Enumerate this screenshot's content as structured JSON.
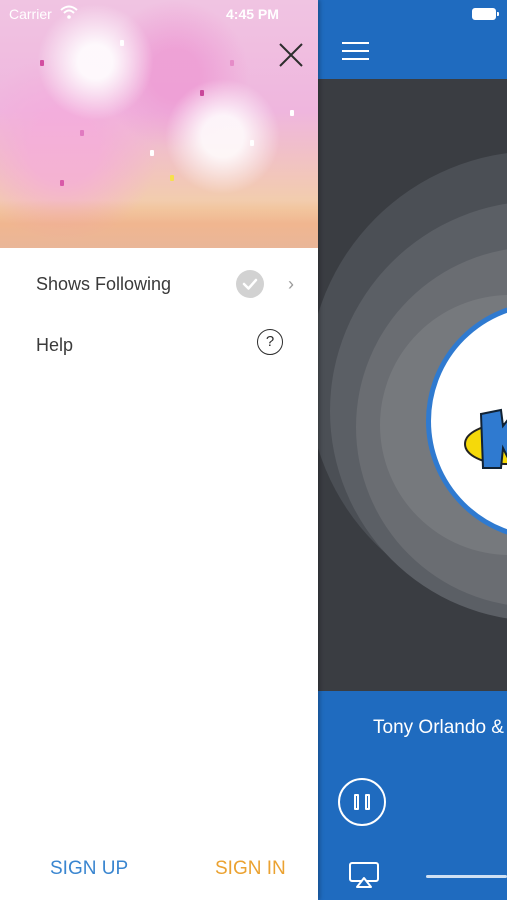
{
  "status_bar": {
    "carrier": "Carrier",
    "time": "4:45 PM",
    "wifi_icon": "wifi-icon",
    "battery_icon": "battery-icon"
  },
  "drawer": {
    "close_icon": "close-icon",
    "menu": [
      {
        "label": "Shows Following",
        "icon": "checkmark-icon",
        "chevron": "›"
      },
      {
        "label": "Help",
        "icon": "question-icon",
        "icon_text": "?"
      }
    ],
    "sign_up_label": "SIGN UP",
    "sign_in_label": "SIGN IN"
  },
  "player": {
    "menu_icon": "hamburger-menu-icon",
    "now_playing": "Tony Orlando &",
    "pause_icon": "pause-icon",
    "airplay_icon": "airplay-icon"
  },
  "colors": {
    "brand_blue": "#1f6bbf",
    "sign_up": "#3a86d0",
    "sign_in": "#eba231",
    "art_background": "#3a3d42",
    "logo_yellow": "#f5d90a"
  }
}
